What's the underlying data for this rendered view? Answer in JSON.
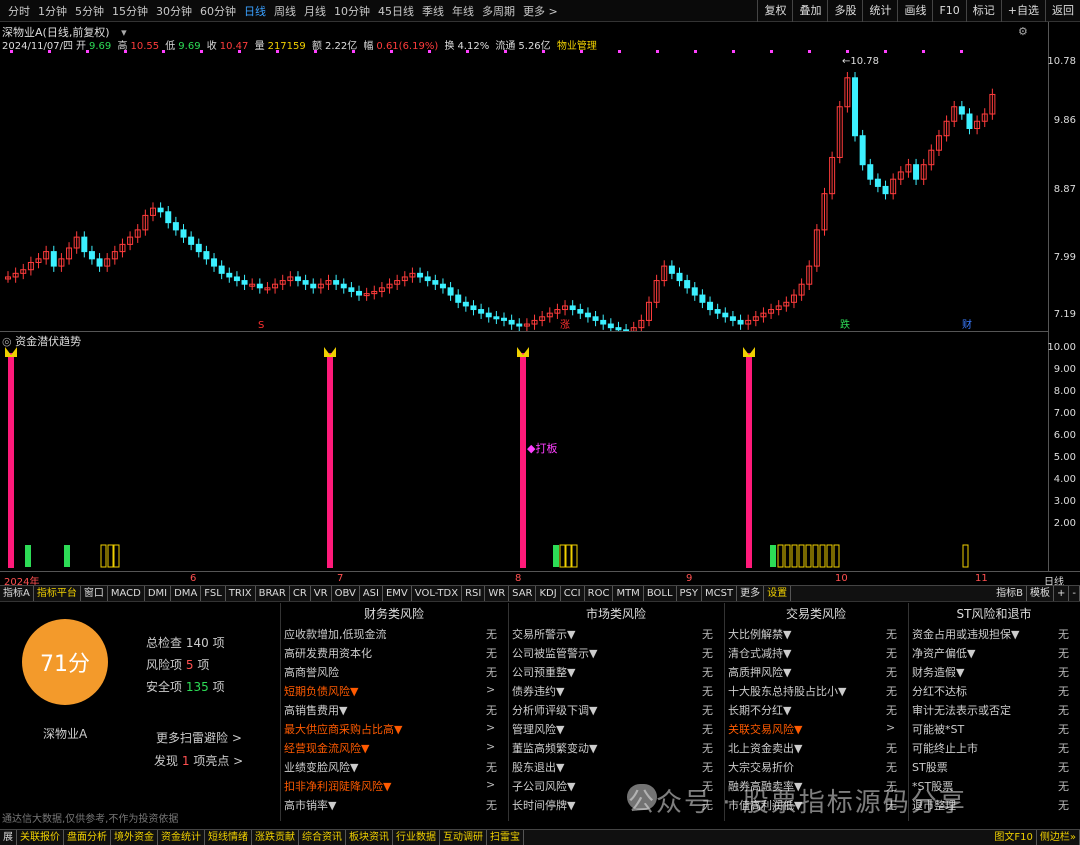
{
  "topbar": {
    "periods": [
      "分时",
      "1分钟",
      "5分钟",
      "15分钟",
      "30分钟",
      "60分钟",
      "日线",
      "周线",
      "月线",
      "10分钟",
      "45日线",
      "季线",
      "年线",
      "多周期",
      "更多 >"
    ],
    "active_period": "日线",
    "right_buttons": [
      "复权",
      "叠加",
      "多股",
      "统计",
      "画线",
      "F10",
      "标记",
      "+自选",
      "返回"
    ]
  },
  "header": {
    "title": "深物业A(日线,前复权)",
    "date": "2024/11/07/四",
    "open_label": "开",
    "open": "9.69",
    "high_label": "高",
    "high": "10.55",
    "low_label": "低",
    "low": "9.69",
    "close_label": "收",
    "close": "10.47",
    "vol_label": "量",
    "vol": "217159",
    "amount_label": "额",
    "amount": "2.22亿",
    "change_label": "幅",
    "change": "0.61(6.19%)",
    "turnover_label": "换",
    "turnover": "4.12%",
    "float_label": "流通",
    "float": "5.26亿",
    "sector": "物业管理"
  },
  "price_axis": [
    "10.78",
    "9.86",
    "8.87",
    "7.99",
    "7.19"
  ],
  "price_annotations": {
    "high": "10.78",
    "low": "7.18"
  },
  "chart_markers": [
    {
      "text": "S",
      "color": "#ff3030"
    },
    {
      "text": "涨",
      "color": "#ff3030"
    },
    {
      "text": "跌",
      "color": "#2ddc56"
    },
    {
      "text": "财",
      "color": "#3a7bff"
    }
  ],
  "sub_indicator": {
    "title": "资金潜伏趋势",
    "label": "打板",
    "axis": [
      "10.00",
      "9.00",
      "8.00",
      "7.00",
      "6.00",
      "5.00",
      "4.00",
      "3.00",
      "2.00"
    ]
  },
  "date_axis": [
    "2024年",
    "6",
    "7",
    "8",
    "9",
    "10",
    "11"
  ],
  "date_axis_right": "日线",
  "indicator_tabs": [
    "指标A",
    "指标平台",
    "窗口",
    "MACD",
    "DMI",
    "DMA",
    "FSL",
    "TRIX",
    "BRAR",
    "CR",
    "VR",
    "OBV",
    "ASI",
    "EMV",
    "VOL-TDX",
    "RSI",
    "WR",
    "SAR",
    "KDJ",
    "CCI",
    "ROC",
    "MTM",
    "BOLL",
    "PSY",
    "MCST",
    "更多",
    "设置"
  ],
  "indicator_tabs_right": [
    "指标B",
    "模板",
    "+",
    "-"
  ],
  "panel": {
    "score": "71分",
    "stock_name": "深物业A",
    "total_label": "总检查",
    "total": "140",
    "total_unit": "项",
    "risk_label": "风险项",
    "risk": "5",
    "risk_unit": "项",
    "safe_label": "安全项",
    "safe": "135",
    "safe_unit": "项",
    "more": "更多扫雷避险 >",
    "discover_prefix": "发现",
    "discover_count": "1",
    "discover_suffix": "项亮点 >",
    "disclaimer": "通达信大数据,仅供参考,不作为投资依据",
    "columns": [
      {
        "title": "财务类风险",
        "rows": [
          {
            "label": "应收款增加,低现金流",
            "val": "无",
            "warn": false
          },
          {
            "label": "高研发费用资本化",
            "val": "无",
            "warn": false
          },
          {
            "label": "高商誉风险",
            "val": "无",
            "warn": false
          },
          {
            "label": "短期负债风险▼",
            "val": ">",
            "warn": true
          },
          {
            "label": "高销售费用▼",
            "val": "无",
            "warn": false
          },
          {
            "label": "最大供应商采购占比高▼",
            "val": ">",
            "warn": true
          },
          {
            "label": "经营现金流风险▼",
            "val": ">",
            "warn": true
          },
          {
            "label": "业绩变脸风险▼",
            "val": "无",
            "warn": false
          },
          {
            "label": "扣非净利润陡降风险▼",
            "val": ">",
            "warn": true
          },
          {
            "label": "高市销率▼",
            "val": "无",
            "warn": false
          }
        ]
      },
      {
        "title": "市场类风险",
        "rows": [
          {
            "label": "交易所警示▼",
            "val": "无",
            "warn": false
          },
          {
            "label": "公司被监管警示▼",
            "val": "无",
            "warn": false
          },
          {
            "label": "公司预重整▼",
            "val": "无",
            "warn": false
          },
          {
            "label": "债券违约▼",
            "val": "无",
            "warn": false
          },
          {
            "label": "分析师评级下调▼",
            "val": "无",
            "warn": false
          },
          {
            "label": "管理风险▼",
            "val": "无",
            "warn": false
          },
          {
            "label": "董监高频繁变动▼",
            "val": "无",
            "warn": false
          },
          {
            "label": "股东退出▼",
            "val": "无",
            "warn": false
          },
          {
            "label": "子公司风险▼",
            "val": "无",
            "warn": false
          },
          {
            "label": "长时间停牌▼",
            "val": "无",
            "warn": false
          }
        ]
      },
      {
        "title": "交易类风险",
        "rows": [
          {
            "label": "大比例解禁▼",
            "val": "无",
            "warn": false
          },
          {
            "label": "清仓式减持▼",
            "val": "无",
            "warn": false
          },
          {
            "label": "高质押风险▼",
            "val": "无",
            "warn": false
          },
          {
            "label": "十大股东总持股占比小▼",
            "val": "无",
            "warn": false
          },
          {
            "label": "长期不分红▼",
            "val": "无",
            "warn": false
          },
          {
            "label": "关联交易风险▼",
            "val": ">",
            "warn": true
          },
          {
            "label": "北上资金卖出▼",
            "val": "无",
            "warn": false
          },
          {
            "label": "大宗交易折价",
            "val": "无",
            "warn": false
          },
          {
            "label": "融券高融卖率▼",
            "val": "无",
            "warn": false
          },
          {
            "label": "市值高利润低▼",
            "val": "无",
            "warn": false
          }
        ]
      },
      {
        "title": "ST风险和退市",
        "rows": [
          {
            "label": "资金占用或违规担保▼",
            "val": "无",
            "warn": false
          },
          {
            "label": "净资产偏低▼",
            "val": "无",
            "warn": false
          },
          {
            "label": "财务造假▼",
            "val": "无",
            "warn": false
          },
          {
            "label": "分红不达标",
            "val": "无",
            "warn": false
          },
          {
            "label": "审计无法表示或否定",
            "val": "无",
            "warn": false
          },
          {
            "label": "可能被*ST",
            "val": "无",
            "warn": false
          },
          {
            "label": "可能终止上市",
            "val": "无",
            "warn": false
          },
          {
            "label": "ST股票",
            "val": "无",
            "warn": false
          },
          {
            "label": "*ST股票",
            "val": "无",
            "warn": false
          },
          {
            "label": "退市整理",
            "val": "无",
            "warn": false
          }
        ]
      }
    ]
  },
  "watermark": "公众号 · 股票指标源码分享",
  "bottombar": [
    "展",
    "关联报价",
    "盘面分析",
    "境外资金",
    "资金统计",
    "短线情绪",
    "涨跌贡献",
    "综合资讯",
    "板块资讯",
    "行业数据",
    "互动调研",
    "扫雷宝"
  ],
  "bottombar_right": [
    "图文F10",
    "侧边栏»"
  ],
  "colors": {
    "up": "#ff3c3c",
    "down": "#3cf0ff",
    "bar": "#ff1a7a",
    "green": "#2ddc56",
    "yellow": "#f0d000",
    "score": "#f39a2b"
  }
}
